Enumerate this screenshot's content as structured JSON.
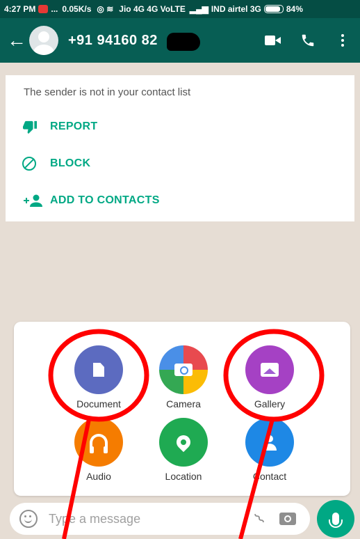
{
  "status_bar": {
    "time": "4:27 PM",
    "dots": "...",
    "speed": "0.05K/s",
    "network_1": "Jio 4G 4G VoLTE",
    "network_2": "IND airtel 3G",
    "battery": "84%"
  },
  "header": {
    "contact_number": "+91 94160 82",
    "back_icon": "arrow-left-icon",
    "video_icon": "video-call-icon",
    "call_icon": "phone-icon",
    "menu_icon": "more-vert-icon"
  },
  "sender_card": {
    "notice": "The sender is not in your contact list",
    "actions": [
      {
        "label": "REPORT",
        "icon": "thumbs-down-icon"
      },
      {
        "label": "BLOCK",
        "icon": "block-icon"
      },
      {
        "label": "ADD TO CONTACTS",
        "icon": "add-person-icon"
      }
    ]
  },
  "attach_menu": {
    "items": [
      {
        "label": "Document",
        "icon": "document-icon",
        "color": "#5c6bc0"
      },
      {
        "label": "Camera",
        "icon": "camera-icon",
        "color": "#e84a4f"
      },
      {
        "label": "Gallery",
        "icon": "gallery-icon",
        "color": "#a541c4"
      },
      {
        "label": "Audio",
        "icon": "headphones-icon",
        "color": "#f57c00"
      },
      {
        "label": "Location",
        "icon": "location-pin-icon",
        "color": "#1faa52"
      },
      {
        "label": "Contact",
        "icon": "contact-icon",
        "color": "#1e88e5"
      }
    ]
  },
  "input_bar": {
    "placeholder": "Type a message",
    "emoji_icon": "emoji-icon",
    "attach_icon": "paperclip-icon",
    "camera_icon": "camera-icon",
    "mic_icon": "mic-icon"
  },
  "colors": {
    "header": "#075e54",
    "accent": "#00a884",
    "annotation": "#ff0000"
  }
}
